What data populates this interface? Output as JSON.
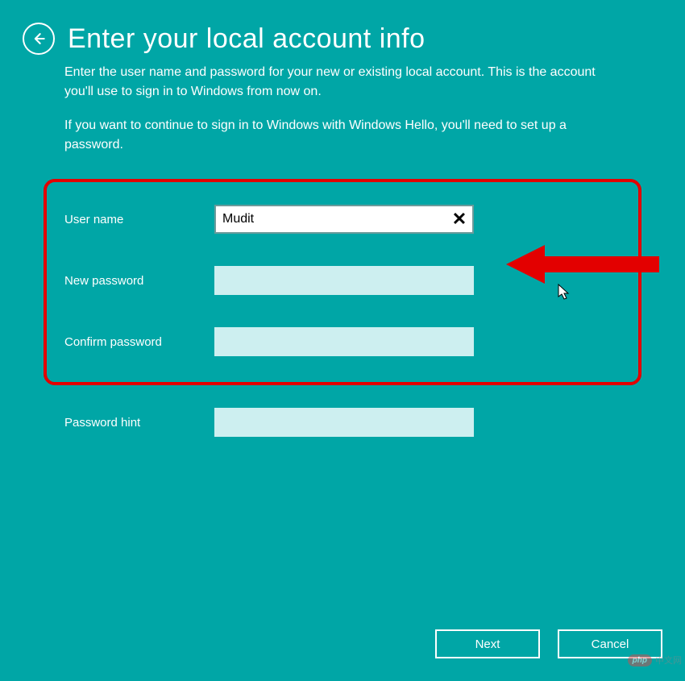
{
  "header": {
    "title": "Enter your local account info"
  },
  "instructions": {
    "p1": "Enter the user name and password for your new or existing local account. This is the account you'll use to sign in to Windows from now on.",
    "p2": "If you want to continue to sign in to Windows with Windows Hello, you'll need to set up a password."
  },
  "form": {
    "username_label": "User name",
    "username_value": "Mudit",
    "new_password_label": "New password",
    "new_password_value": "",
    "confirm_password_label": "Confirm password",
    "confirm_password_value": "",
    "password_hint_label": "Password hint",
    "password_hint_value": ""
  },
  "footer": {
    "next_label": "Next",
    "cancel_label": "Cancel"
  },
  "watermark": {
    "badge": "php",
    "text": "中文网"
  },
  "colors": {
    "background": "#00A6A6",
    "highlight_border": "#E30000",
    "pale_input": "#CDEFF0"
  }
}
